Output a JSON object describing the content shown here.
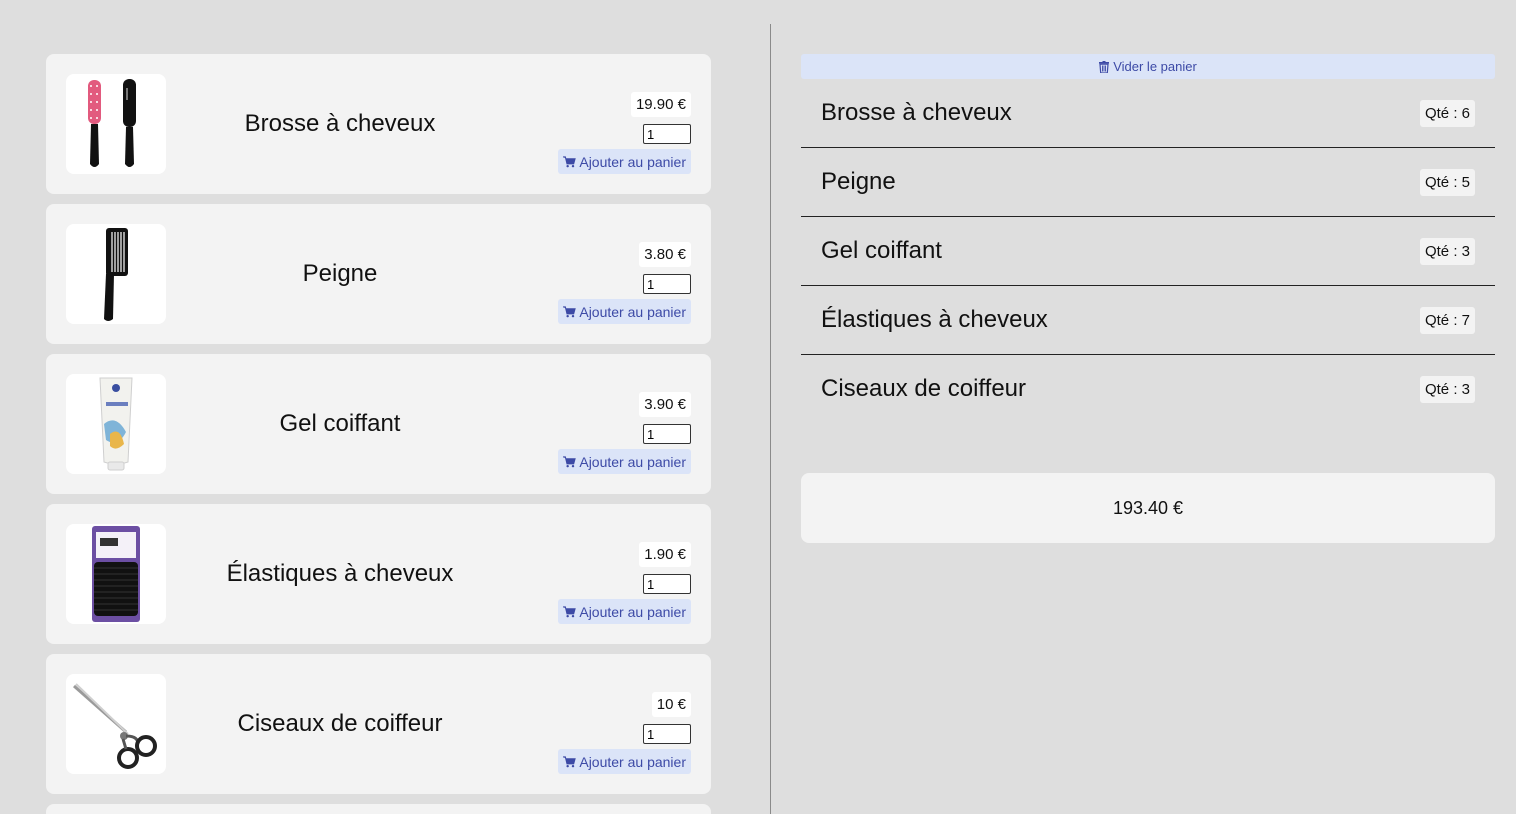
{
  "products": [
    {
      "name": "Brosse à cheveux",
      "price": "19.90 €",
      "quantity": "1",
      "add_label": "Ajouter au panier",
      "image_icon": "hairbrush-icon"
    },
    {
      "name": "Peigne",
      "price": "3.80 €",
      "quantity": "1",
      "add_label": "Ajouter au panier",
      "image_icon": "comb-icon"
    },
    {
      "name": "Gel coiffant",
      "price": "3.90 €",
      "quantity": "1",
      "add_label": "Ajouter au panier",
      "image_icon": "gel-tube-icon"
    },
    {
      "name": "Élastiques à cheveux",
      "price": "1.90 €",
      "quantity": "1",
      "add_label": "Ajouter au panier",
      "image_icon": "hair-ties-icon"
    },
    {
      "name": "Ciseaux de coiffeur",
      "price": "10 €",
      "quantity": "1",
      "add_label": "Ajouter au panier",
      "image_icon": "scissors-icon"
    }
  ],
  "cart": {
    "clear_label": "Vider le panier",
    "items": [
      {
        "name": "Brosse à cheveux",
        "qty": "Qté : 6"
      },
      {
        "name": "Peigne",
        "qty": "Qté : 5"
      },
      {
        "name": "Gel coiffant",
        "qty": "Qté : 3"
      },
      {
        "name": "Élastiques à cheveux",
        "qty": "Qté : 7"
      },
      {
        "name": "Ciseaux de coiffeur",
        "qty": "Qté : 3"
      }
    ],
    "total": "193.40 €"
  },
  "colors": {
    "background": "#dedede",
    "card": "#f3f3f3",
    "button_bg": "#dbe4f8",
    "button_text": "#3d4aa6"
  }
}
